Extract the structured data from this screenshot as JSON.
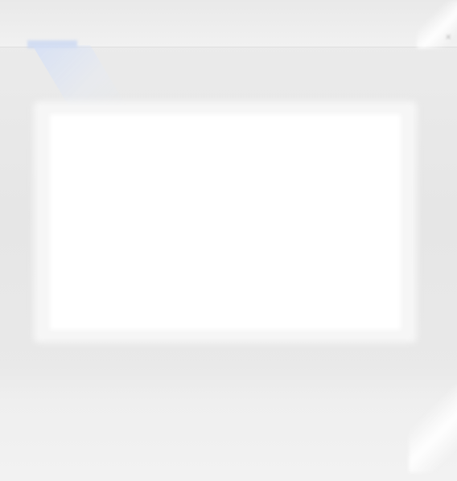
{
  "header": {
    "title": "",
    "description": "",
    "link_label": "",
    "close_glyph": "×"
  },
  "content": {
    "heading": "",
    "body": ""
  },
  "colors": {
    "background": "#e8e8e8",
    "panel": "#ffffff",
    "link_highlight": "#c9d7f2",
    "heading_text": "#2c2c2c"
  },
  "icons": {
    "close": "close-icon"
  }
}
